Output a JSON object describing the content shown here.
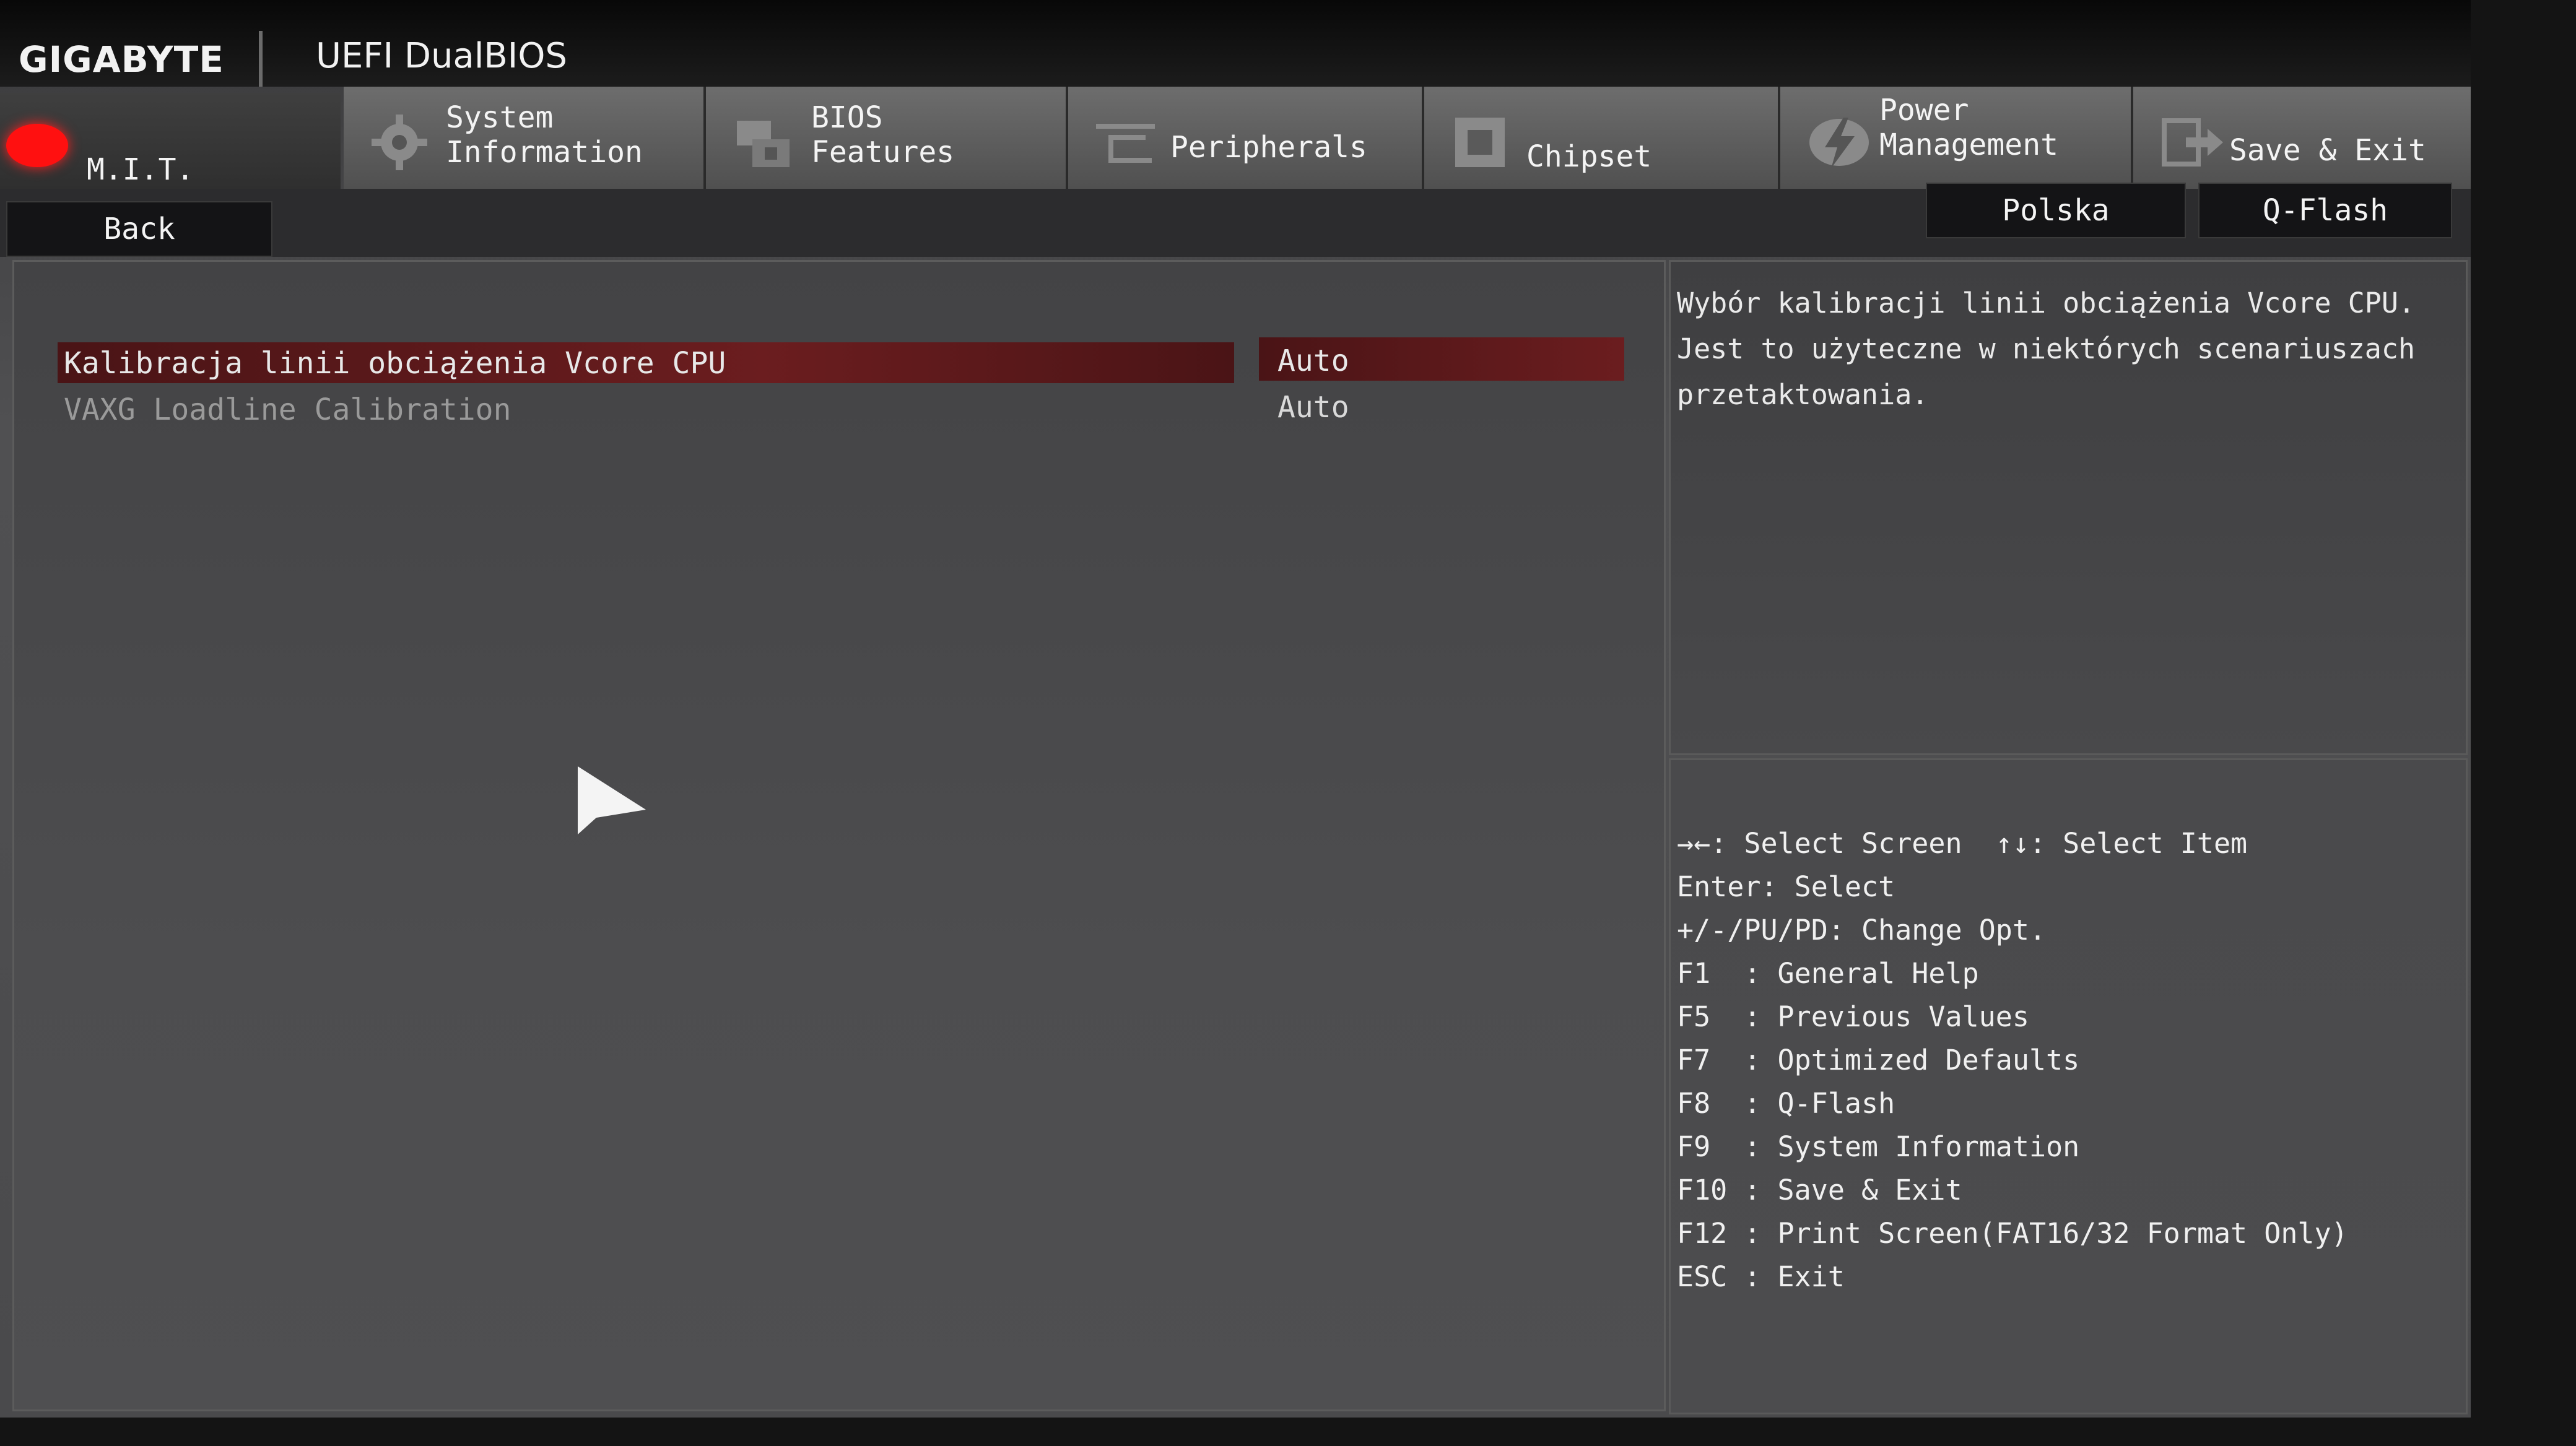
{
  "header": {
    "brand": "GIGABYTE",
    "product": "UEFI DualBIOS"
  },
  "tabs": {
    "mit": "M.I.T.",
    "system_information": "System\nInformation",
    "bios_features": "BIOS\nFeatures",
    "peripherals": "Peripherals",
    "chipset": "Chipset",
    "power_management": "Power\nManagement",
    "save_exit": "Save & Exit"
  },
  "toolbar": {
    "back": "Back",
    "language": "Polska",
    "qflash": "Q-Flash"
  },
  "settings": [
    {
      "name": "Kalibracja linii obciążenia Vcore CPU",
      "value": "Auto"
    },
    {
      "name": "VAXG Loadline Calibration",
      "value": "Auto"
    }
  ],
  "help": {
    "description": "Wybór kalibracji linii obciążenia Vcore CPU. Jest to użyteczne w niektórych scenariuszach przetaktowania."
  },
  "keys": [
    "→←: Select Screen  ↑↓: Select Item",
    "Enter: Select",
    "+/-/PU/PD: Change Opt.",
    "F1  : General Help",
    "F5  : Previous Values",
    "F7  : Optimized Defaults",
    "F8  : Q-Flash",
    "F9  : System Information",
    "F10 : Save & Exit",
    "F12 : Print Screen(FAT16/32 Format Only)",
    "ESC : Exit"
  ],
  "colors": {
    "selection": "#6b1d1f",
    "mit_indicator": "#ff1010"
  }
}
